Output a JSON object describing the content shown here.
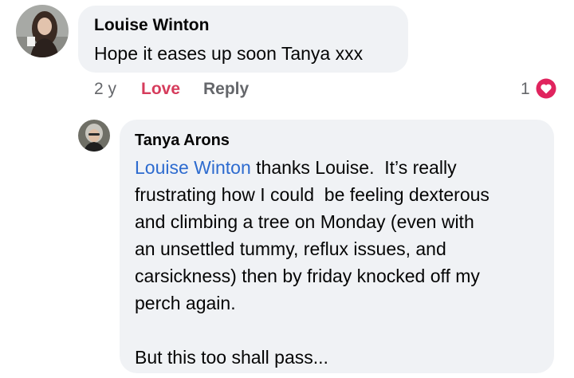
{
  "comment": {
    "author": "Louise Winton",
    "text": "Hope it eases up soon Tanya xxx",
    "time": "2 y",
    "love_label": "Love",
    "reply_label": "Reply",
    "reaction_count": "1",
    "reaction_icon": "heart-icon",
    "reaction_color": "#e0245e",
    "love_color": "#d63c5c"
  },
  "reply": {
    "author": "Tanya Arons",
    "mention": "Louise Winton",
    "lines": [
      " thanks Louise.  It’s really",
      "frustrating how I could  be feeling dexterous",
      "and climbing a tree on Monday (even with",
      "an unsettled tummy, reflux issues, and",
      "carsickness) then by friday knocked off my",
      "perch again."
    ],
    "closing": "But this too shall pass..."
  }
}
